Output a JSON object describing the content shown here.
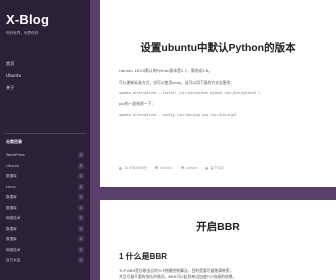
{
  "site": {
    "title": "X-Blog",
    "tagline": "你好世界，世界你好"
  },
  "nav": {
    "items": [
      {
        "label": "首页"
      },
      {
        "label": "Ubuntu"
      },
      {
        "label": "关于"
      }
    ]
  },
  "categories": {
    "title": "分类目录",
    "items": [
      {
        "label": "WordPress",
        "count": "1"
      },
      {
        "label": "Ubuntu",
        "count": "2"
      },
      {
        "label": "数据库",
        "count": "1"
      },
      {
        "label": "Linux",
        "count": "2"
      },
      {
        "label": "数据库",
        "count": "1"
      },
      {
        "label": "数据库",
        "count": "1"
      },
      {
        "label": "网络技术",
        "count": "1"
      },
      {
        "label": "数据库",
        "count": "1"
      },
      {
        "label": "数据库",
        "count": "1"
      },
      {
        "label": "网络技术",
        "count": "1"
      },
      {
        "label": "百万大会",
        "count": "1"
      }
    ]
  },
  "posts": [
    {
      "title": "设置ubuntu中默认Python的版本",
      "lines": [
        "Ubuntu 18.04默认的Python版本是2.7，需改成3.6。",
        "可以更新标准方式，也可以使用alias，这可以用下面的方式去更改："
      ],
      "code_lines": [
        "update-alternatives --install  /usr/bin/python python /usr/bin/python3 1",
        "update-alternatives --config   /usr/bin/pip pip  /usr/bin/pip3"
      ],
      "mid_line": "pip也一起修改一下：",
      "meta": {
        "date": "2019年6月6日",
        "category": "Ubuntu",
        "tag": "python",
        "comment": "留下评论"
      }
    },
    {
      "title": "开启BBR",
      "subhead": "1 什么是BBR",
      "lines": [
        "TCP BBR是谷歌出品的TCP拥塞控制算法，目的是要尽量跑满带宽，",
        "并且尽量不要有排队的情况，BBR可以起到单边加速TCP连接的效果。"
      ]
    }
  ]
}
